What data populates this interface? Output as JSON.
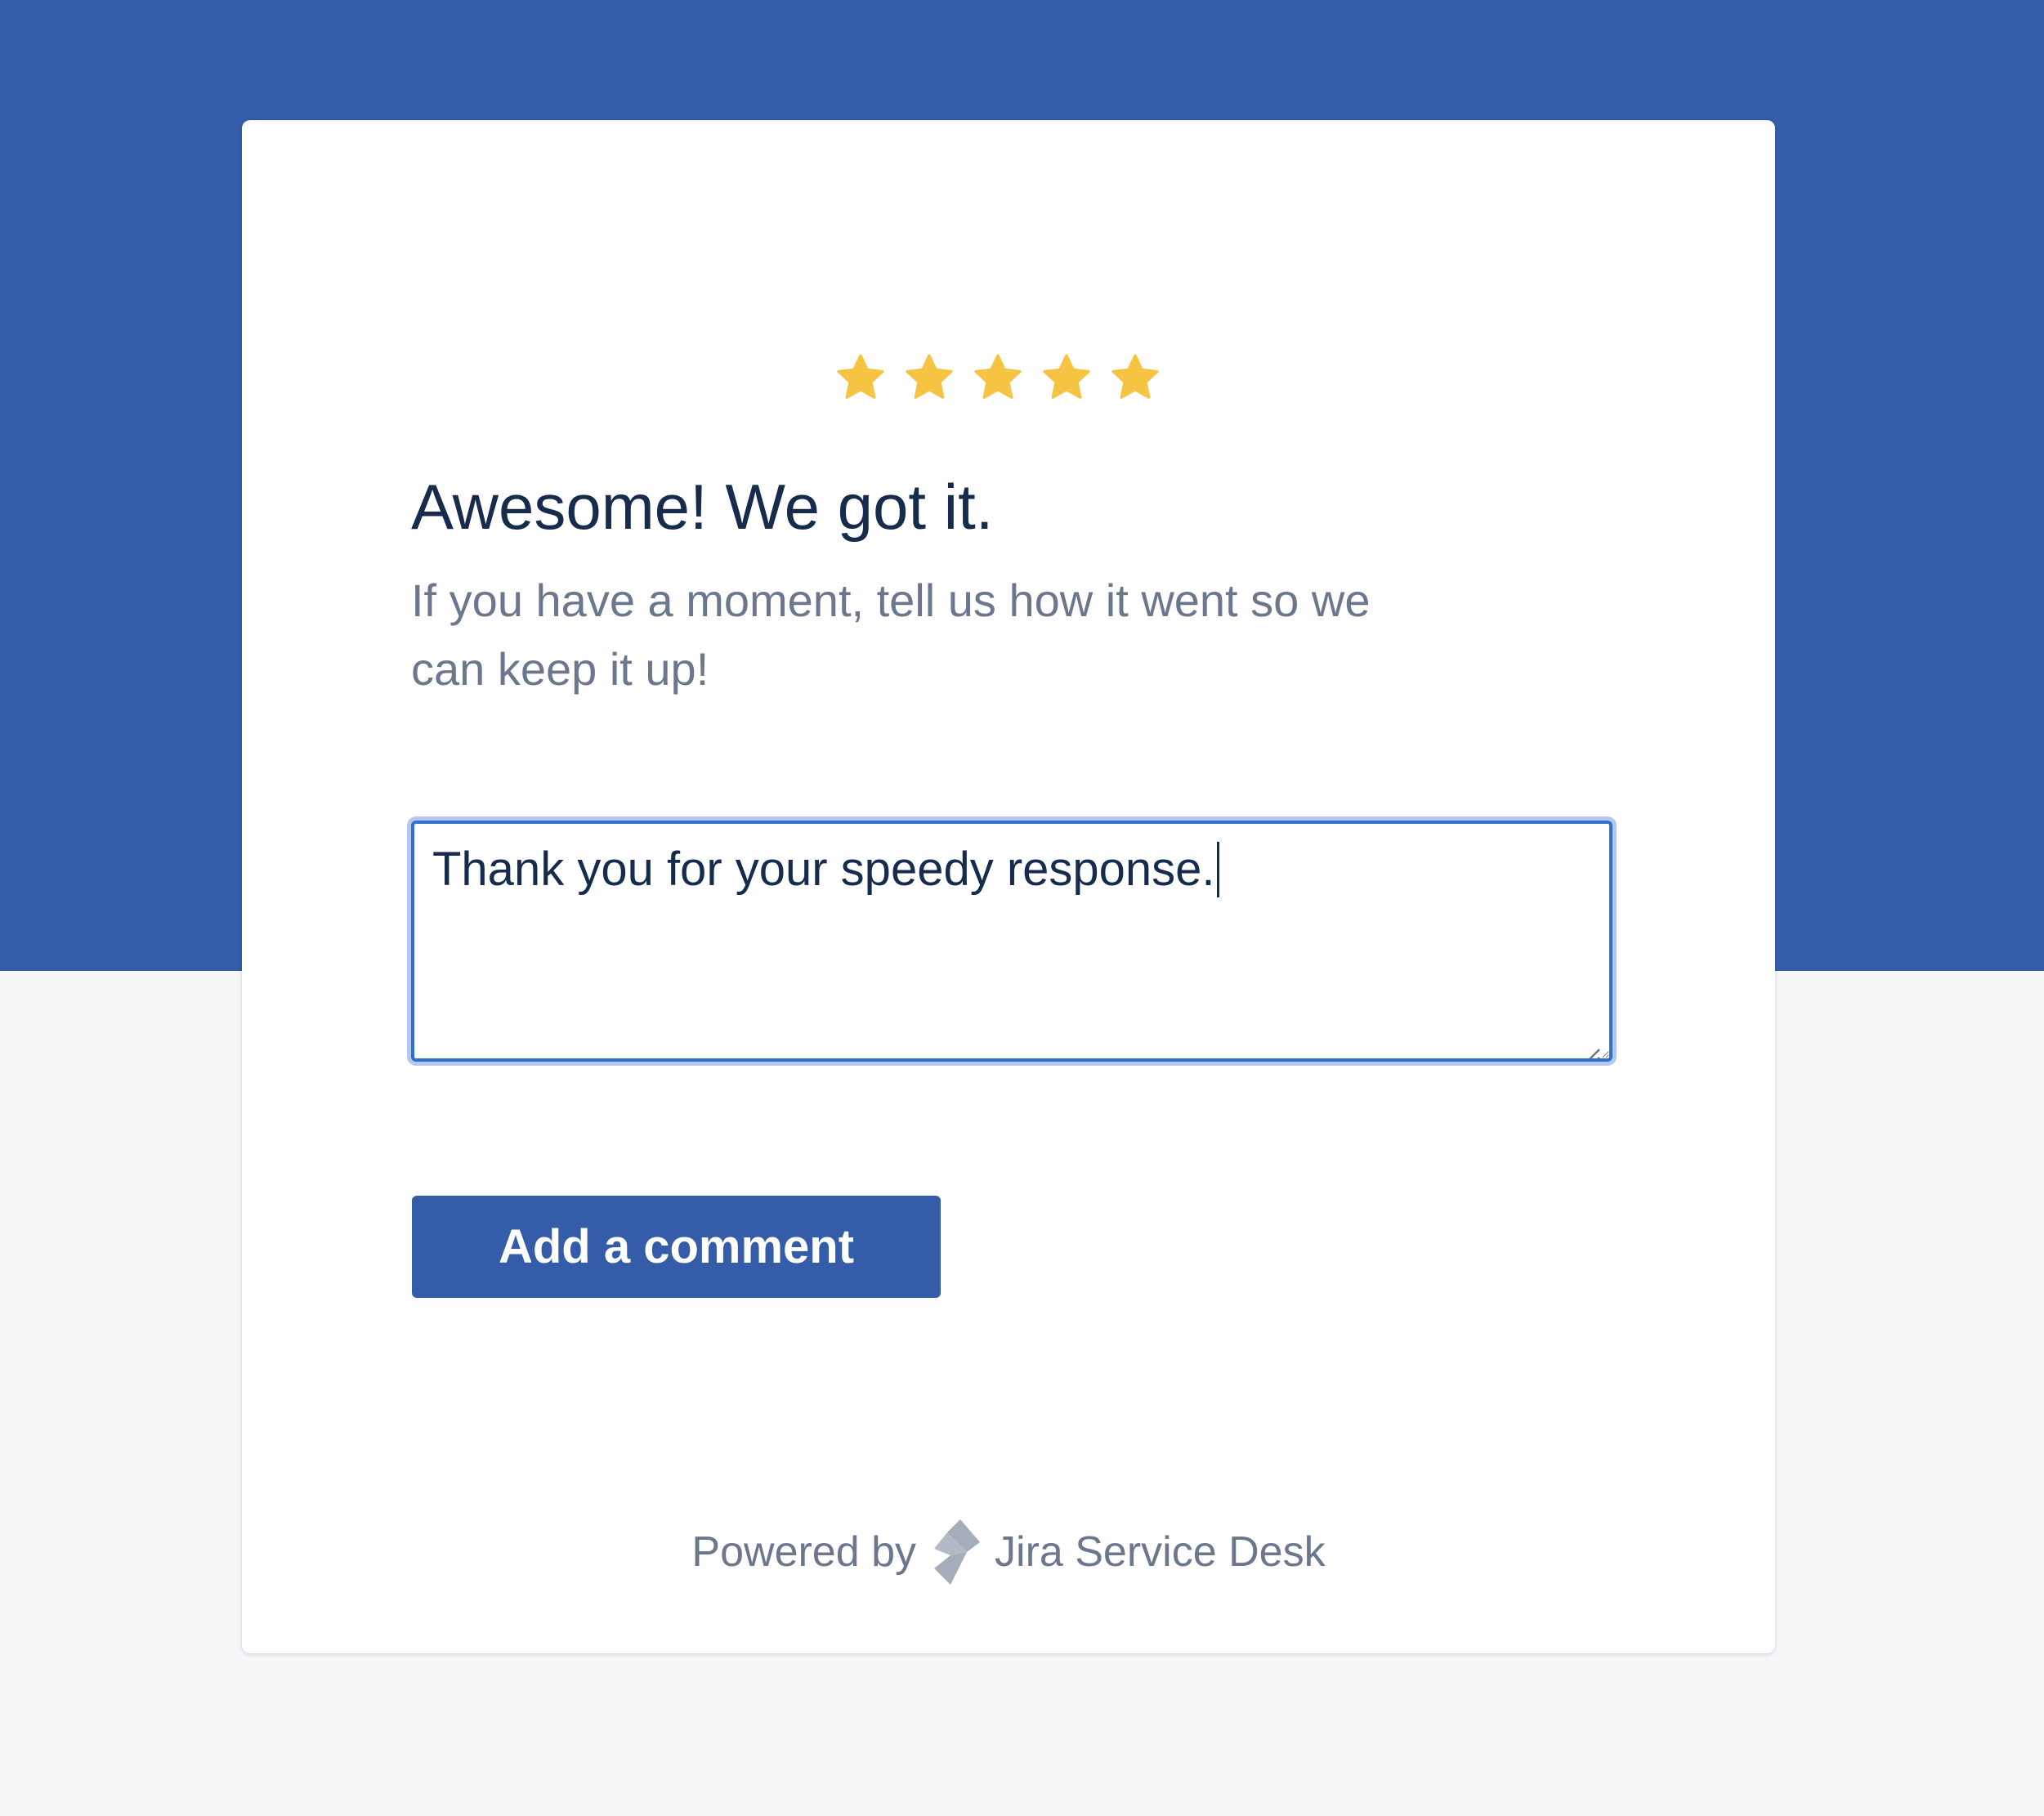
{
  "feedback": {
    "rating": 5,
    "rating_max": 5,
    "star_color": "#f6c342",
    "title": "Awesome! We got it.",
    "subtitle": "If you have a moment, tell us how it went so we can keep it up!",
    "comment_value": "Thank you for your speedy response.",
    "submit_label": "Add a comment"
  },
  "footer": {
    "powered_by": "Powered by",
    "product_name": "Jira Service Desk",
    "logo_icon": "jira-service-desk-icon"
  },
  "colors": {
    "brand": "#345ca9",
    "page_background": "#f6f7f9",
    "text_primary": "#172b4d",
    "text_secondary": "#6b778c",
    "focus_border": "#2f6fd0"
  }
}
